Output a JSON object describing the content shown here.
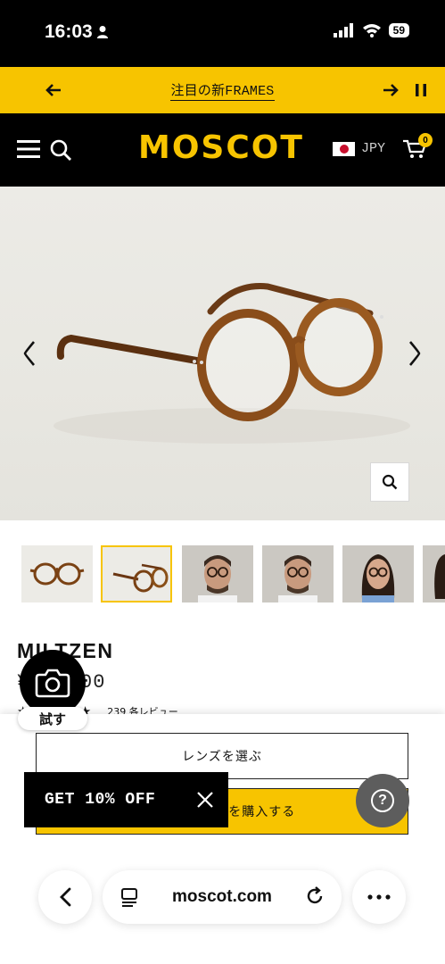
{
  "status_bar": {
    "time": "16:03",
    "battery": "59"
  },
  "promo": {
    "text_jp": "注目の新",
    "text_latin": "FRAMES"
  },
  "header": {
    "logo": "MOSCOT",
    "currency": "JPY",
    "cart_count": "0"
  },
  "product": {
    "name": "MILTZEN",
    "price": "¥59,400",
    "rating_stars": 5,
    "review_count": "239 各レビュー"
  },
  "actions": {
    "lens_button": "レンズを選ぶ",
    "buy_button": "フレームのみを購入する",
    "try_on_label": "試す"
  },
  "discount": {
    "text": "GET 10% OFF"
  },
  "help": {
    "label": "?"
  },
  "browser": {
    "url": "moscot.com"
  },
  "colors": {
    "brand_yellow": "#f7c400",
    "header_black": "#000000"
  },
  "icons": [
    "person-icon",
    "signal-icon",
    "wifi-icon",
    "arrow-left-icon",
    "arrow-right-icon",
    "pause-icon",
    "menu-icon",
    "search-icon",
    "cart-icon",
    "chevron-left-icon",
    "chevron-right-icon",
    "zoom-icon",
    "camera-icon",
    "close-icon",
    "help-icon",
    "reader-icon",
    "reload-icon",
    "more-icon"
  ]
}
